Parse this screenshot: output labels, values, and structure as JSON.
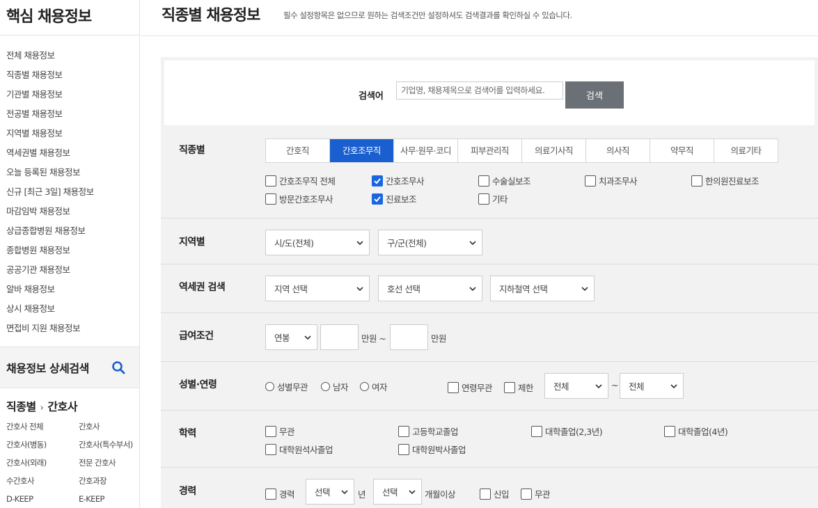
{
  "sidebar": {
    "title": "핵심 채용정보",
    "menu": [
      "전체 채용정보",
      "직종별 채용정보",
      "기관별 채용정보",
      "전공별 채용정보",
      "지역별 채용정보",
      "역세권별 채용정보",
      "오늘 등록된 채용정보",
      "신규 [최근 3일] 채용정보",
      "마감임박 채용정보",
      "상급종합병원 채용정보",
      "종합병원 채용정보",
      "공공기관 채용정보",
      "알바 채용정보",
      "상시 채용정보",
      "면접비 지원 채용정보"
    ],
    "detail_search": "채용정보 상세검색",
    "path_first": "직종별",
    "path_sep": "›",
    "path_second": "간호사",
    "sub_items": [
      "간호사 전체",
      "간호사",
      "간호사(병동)",
      "간호사(특수부서)",
      "간호사(외래)",
      "전문 간호사",
      "수간호사",
      "간호과장",
      "D-KEEP",
      "E-KEEP"
    ]
  },
  "header": {
    "title": "직종별 채용정보",
    "desc": "필수 설정항목은 없으므로 원하는 검색조건만 설정하셔도 검색결과를 확인하실 수 있습니다."
  },
  "keyword": {
    "label": "검색어",
    "placeholder": "기업명, 채용제목으로 검색어를 입력하세요.",
    "button": "검색"
  },
  "job": {
    "label": "직종별",
    "tabs": [
      "간호직",
      "간호조무직",
      "사무·원무·코디",
      "피부관리직",
      "의료기사직",
      "의사직",
      "약무직",
      "의료기타"
    ],
    "active_tab": "간호조무직",
    "options": [
      {
        "label": "간호조무직 전체",
        "checked": false
      },
      {
        "label": "간호조무사",
        "checked": true
      },
      {
        "label": "수술실보조",
        "checked": false
      },
      {
        "label": "치과조무사",
        "checked": false
      },
      {
        "label": "한의원진료보조",
        "checked": false
      },
      {
        "label": "방문간호조무사",
        "checked": false
      },
      {
        "label": "진료보조",
        "checked": true
      },
      {
        "label": "기타",
        "checked": false
      }
    ]
  },
  "region": {
    "label": "지역별",
    "sido": "시/도(전체)",
    "gugun": "구/군(전체)"
  },
  "station": {
    "label": "역세권 검색",
    "area": "지역 선택",
    "line": "호선 선택",
    "station": "지하철역 선택"
  },
  "salary": {
    "label": "급여조건",
    "type": "연봉",
    "unit1": "만원 ~",
    "unit2": "만원"
  },
  "gender": {
    "label": "성별·연령",
    "radios": [
      "성별무관",
      "남자",
      "여자"
    ],
    "age_any": "연령무관",
    "age_limit": "제한",
    "from": "전체",
    "tilde": "~",
    "to": "전체"
  },
  "education": {
    "label": "학력",
    "options": [
      "무관",
      "고등학교졸업",
      "대학졸업(2,3년)",
      "대학졸업(4년)",
      "대학원석사졸업",
      "대학원박사졸업"
    ]
  },
  "career": {
    "label": "경력",
    "career": "경력",
    "years": "선택",
    "years_unit": "년",
    "months": "선택",
    "months_unit": "개월이상",
    "newcomer": "신입",
    "any": "무관"
  },
  "colors": {
    "accent": "#1a5fcf",
    "checkbox": "#1a66e0",
    "search_button": "#6b7076",
    "panel_bg": "#f2f2f2"
  }
}
